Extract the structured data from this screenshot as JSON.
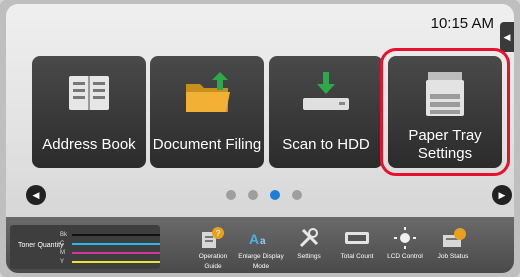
{
  "status": {
    "time": "10:15 AM"
  },
  "tiles": [
    {
      "label": "Address Book",
      "icon": "address-book-icon"
    },
    {
      "label": "Document Filing",
      "icon": "folder-icon"
    },
    {
      "label": "Scan to HDD",
      "icon": "scan-to-hdd-icon"
    },
    {
      "label": "Paper Tray Settings",
      "icon": "printer-icon"
    }
  ],
  "pager": {
    "count": 4,
    "active_index": 2
  },
  "toner": {
    "label": "Toner Quantity",
    "channels": [
      {
        "name": "Bk",
        "color": "#111111"
      },
      {
        "name": "C",
        "color": "#29b6e8"
      },
      {
        "name": "M",
        "color": "#d4379a"
      },
      {
        "name": "Y",
        "color": "#e8e23a"
      }
    ]
  },
  "bottom_bar": [
    {
      "label": "Operation Guide",
      "icon": "operation-guide-icon"
    },
    {
      "label": "Enlarge Display Mode",
      "icon": "enlarge-display-icon"
    },
    {
      "label": "Settings",
      "icon": "settings-icon"
    },
    {
      "label": "Total Count",
      "icon": "total-count-icon"
    },
    {
      "label": "LCD Control",
      "icon": "lcd-control-icon"
    },
    {
      "label": "Job Status",
      "icon": "job-status-icon"
    }
  ],
  "colors": {
    "highlight": "#e8112d",
    "accent": "#1f7fd6"
  }
}
